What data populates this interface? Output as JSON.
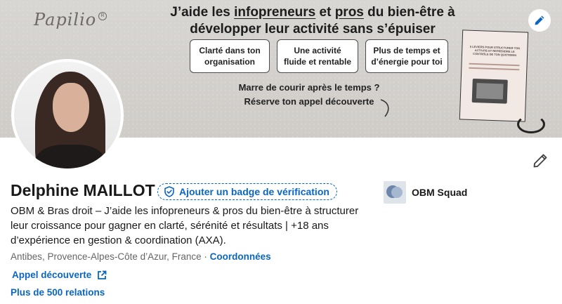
{
  "banner": {
    "brand": "Papilio",
    "headline_pre": "J’aide les ",
    "headline_u1": "infopreneurs",
    "headline_mid": " et ",
    "headline_u2": "pros",
    "headline_post": " du bien-être à développer leur activité sans s’épuiser",
    "pills": [
      "Clarté dans ton organisation",
      "Une activité fluide et rentable",
      "Plus de temps et d’énergie pour toi"
    ],
    "cta_line1": "Marre de courir après le temps ?",
    "cta_line2": "Réserve ton appel découverte",
    "ebook_title": "5 LEVIERS POUR STRUCTURER TON ACTIVITÉ ET REPRENDRE LE CONTRÔLE DE TON QUOTIDIEN"
  },
  "profile": {
    "name": "Delphine MAILLOT",
    "verify_label": "Ajouter un badge de vérification",
    "headline": "OBM & Bras droit – J’aide les infopreneurs & pros du bien-être à structurer leur croissance pour gagner en clarté, sérénité et résultats | +18 ans d’expérience en gestion & coordination (AXA).",
    "location": "Antibes, Provence-Alpes-Côte d’Azur, France",
    "separator": " · ",
    "contact_label": "Coordonnées",
    "link_label": "Appel découverte",
    "connections": "Plus de 500 relations"
  },
  "company": {
    "name": "OBM Squad"
  },
  "icons": {
    "banner_edit": "pencil-icon",
    "profile_edit": "pencil-icon",
    "verify": "shield-check-icon",
    "external": "external-link-icon"
  },
  "colors": {
    "link": "#0a66c2",
    "text": "#191919",
    "muted": "#666666"
  }
}
